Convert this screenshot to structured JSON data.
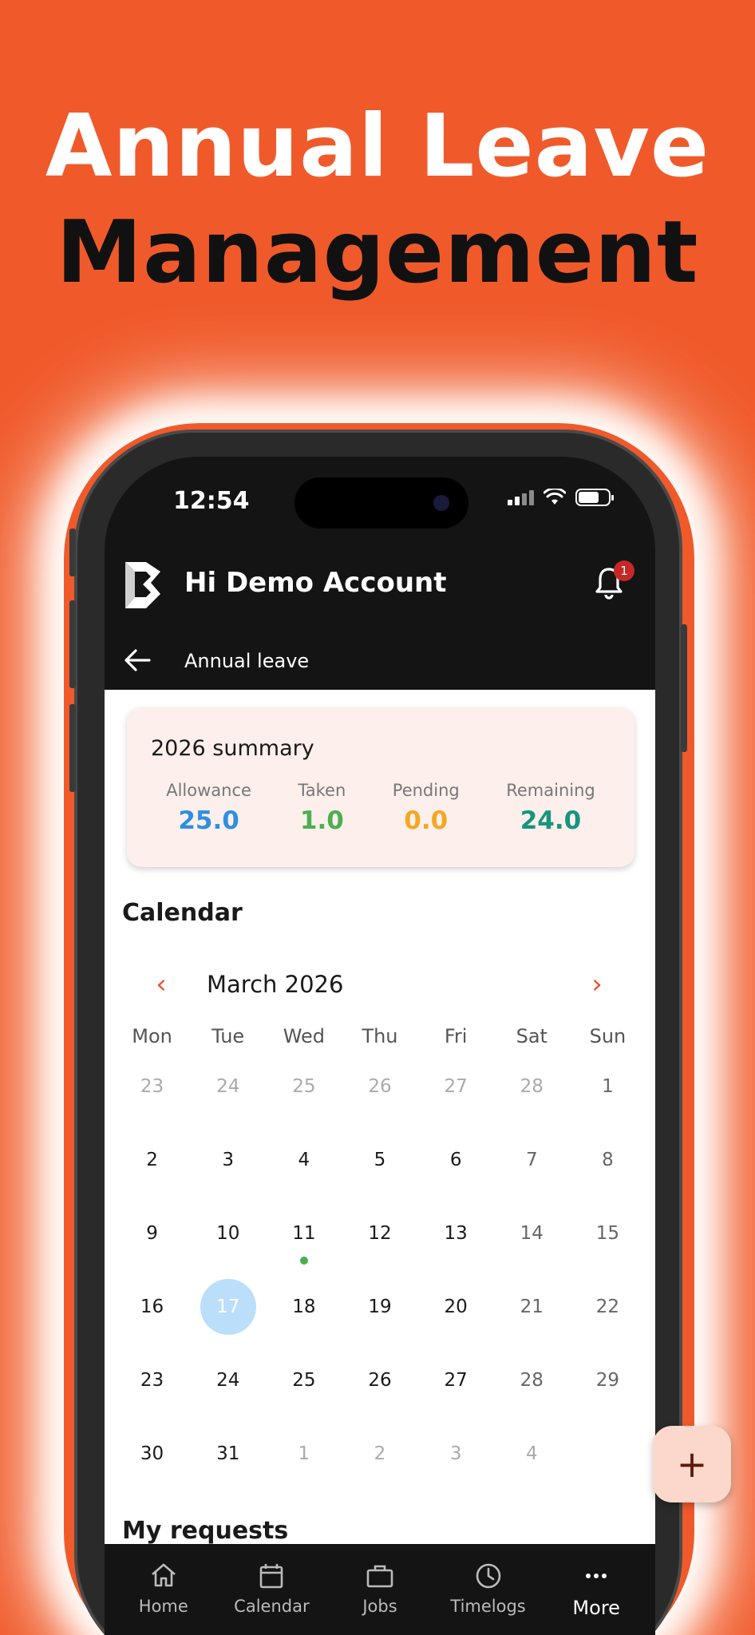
{
  "headline": {
    "line1": "Annual Leave",
    "line2": "Management"
  },
  "status_bar": {
    "time": "12:54"
  },
  "app_bar": {
    "greeting": "Hi Demo Account",
    "notification_count": "1"
  },
  "sub_bar": {
    "title": "Annual leave"
  },
  "summary": {
    "title": "2026 summary",
    "stats": [
      {
        "label": "Allowance",
        "value": "25.0",
        "color": "#2F8FE0"
      },
      {
        "label": "Taken",
        "value": "1.0",
        "color": "#4CAF50"
      },
      {
        "label": "Pending",
        "value": "0.0",
        "color": "#F5A623"
      },
      {
        "label": "Remaining",
        "value": "24.0",
        "color": "#16967D"
      }
    ]
  },
  "calendar": {
    "heading": "Calendar",
    "month": "March 2026",
    "weekdays": [
      "Mon",
      "Tue",
      "Wed",
      "Thu",
      "Fri",
      "Sat",
      "Sun"
    ],
    "weeks": [
      [
        "23",
        "24",
        "25",
        "26",
        "27",
        "28",
        "1"
      ],
      [
        "2",
        "3",
        "4",
        "5",
        "6",
        "7",
        "8"
      ],
      [
        "9",
        "10",
        "11",
        "12",
        "13",
        "14",
        "15"
      ],
      [
        "16",
        "17",
        "18",
        "19",
        "20",
        "21",
        "22"
      ],
      [
        "23",
        "24",
        "25",
        "26",
        "27",
        "28",
        "29"
      ],
      [
        "30",
        "31",
        "1",
        "2",
        "3",
        "4",
        ""
      ]
    ],
    "today": "17",
    "marked_day": "11"
  },
  "requests": {
    "heading": "My requests"
  },
  "fab": {
    "label": "+"
  },
  "bottom_nav": [
    {
      "label": "Home",
      "icon": "home-icon"
    },
    {
      "label": "Calendar",
      "icon": "calendar-icon"
    },
    {
      "label": "Jobs",
      "icon": "briefcase-icon"
    },
    {
      "label": "Timelogs",
      "icon": "clock-icon"
    },
    {
      "label": "More",
      "icon": "more-icon"
    }
  ],
  "colors": {
    "brand": "#F05A2B",
    "accent": "#E8552A",
    "today_fill": "#BBDEFB",
    "leave_dot": "#4CAF50"
  }
}
